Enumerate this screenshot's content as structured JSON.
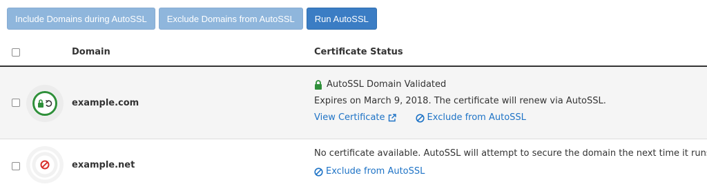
{
  "toolbar": {
    "include_label": "Include Domains during AutoSSL",
    "exclude_label": "Exclude Domains from AutoSSL",
    "run_label": "Run AutoSSL"
  },
  "table": {
    "headers": {
      "domain": "Domain",
      "certificate_status": "Certificate Status"
    },
    "rows": [
      {
        "domain": "example.com",
        "status_title": "AutoSSL Domain Validated",
        "status_detail": "Expires on March 9, 2018. The certificate will renew via AutoSSL.",
        "view_certificate_label": "View Certificate",
        "exclude_label": "Exclude from AutoSSL",
        "icon": "validated-lock-icon"
      },
      {
        "domain": "example.net",
        "status_detail": "No certificate available. AutoSSL will attempt to secure the domain the next time it runs.",
        "exclude_label": "Exclude from AutoSSL",
        "icon": "no-certificate-icon"
      }
    ]
  },
  "colors": {
    "primary_button": "#3b7dc4",
    "disabled_button": "#8fb6dc",
    "link": "#1e73c6",
    "success": "#2f8f3a",
    "danger": "#d9302c",
    "row_alt_bg": "#f5f5f5"
  }
}
